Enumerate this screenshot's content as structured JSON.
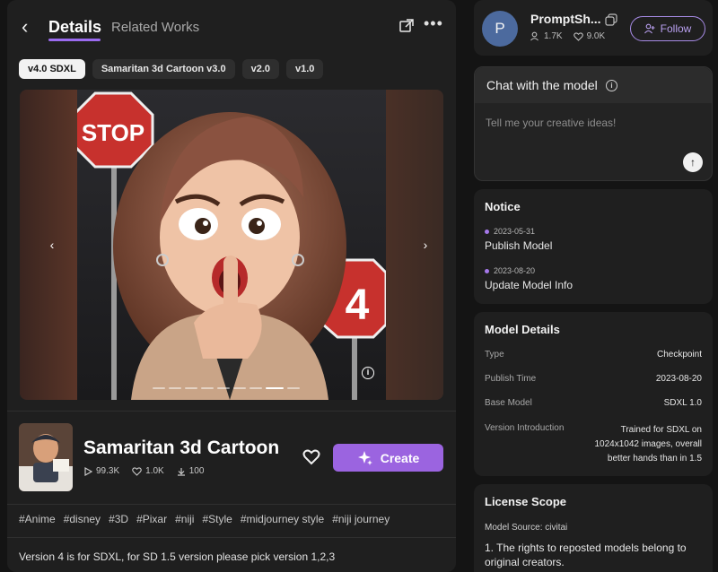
{
  "header": {
    "tabs": [
      {
        "label": "Details",
        "active": true
      },
      {
        "label": "Related Works",
        "active": false
      }
    ]
  },
  "versions": [
    {
      "label": "v4.0 SDXL",
      "active": true
    },
    {
      "label": "Samaritan 3d Cartoon v3.0",
      "active": false
    },
    {
      "label": "v2.0",
      "active": false
    },
    {
      "label": "v1.0",
      "active": false
    }
  ],
  "gallery": {
    "image_count": 9,
    "current_index": 7,
    "stop_sign_text": "STOP",
    "sign_number": "4"
  },
  "model": {
    "title": "Samaritan 3d Cartoon",
    "views": "99.3K",
    "likes": "1.0K",
    "downloads": "100",
    "create_label": "Create"
  },
  "tags": [
    "#Anime",
    "#disney",
    "#3D",
    "#Pixar",
    "#niji",
    "#Style",
    "#midjourney style",
    "#niji journey"
  ],
  "description": "Version 4 is for SDXL, for SD 1.5 version please pick version 1,2,3",
  "author": {
    "avatar_letter": "P",
    "name": "PromptSh...",
    "followers": "1.7K",
    "likes": "9.0K",
    "follow_label": "Follow"
  },
  "chat": {
    "title": "Chat with the model",
    "placeholder": "Tell me your creative ideas!"
  },
  "notice": {
    "title": "Notice",
    "items": [
      {
        "date": "2023-05-31",
        "label": "Publish Model"
      },
      {
        "date": "2023-08-20",
        "label": "Update Model Info"
      }
    ]
  },
  "details": {
    "title": "Model Details",
    "rows": [
      {
        "key": "Type",
        "value": "Checkpoint"
      },
      {
        "key": "Publish Time",
        "value": "2023-08-20"
      },
      {
        "key": "Base Model",
        "value": "SDXL 1.0"
      },
      {
        "key": "Version Introduction",
        "value": "Trained for SDXL on 1024x1042 images, overall better hands than in 1.5"
      }
    ]
  },
  "license": {
    "title": "License Scope",
    "source": "Model Source: civitai",
    "text": "1. The rights to reposted models belong to original creators."
  },
  "colors": {
    "accent": "#9b64e0",
    "background": "#141414",
    "panel": "#1f1f1f"
  }
}
